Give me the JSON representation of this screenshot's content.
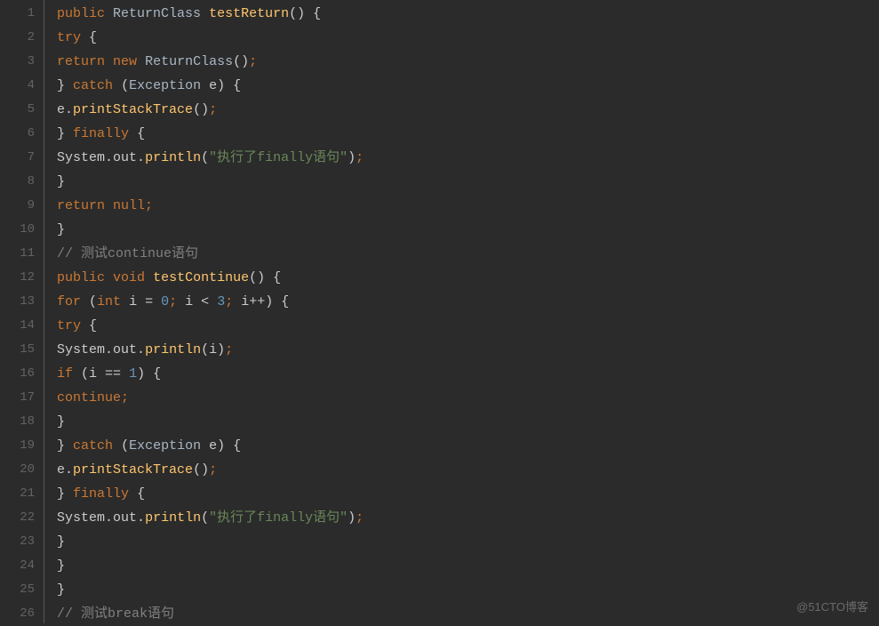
{
  "watermark": "@51CTO博客",
  "lines": [
    {
      "num": "1",
      "tokens": [
        {
          "t": "public",
          "c": "keyword"
        },
        {
          "t": " ",
          "c": "text"
        },
        {
          "t": "ReturnClass",
          "c": "type"
        },
        {
          "t": " ",
          "c": "text"
        },
        {
          "t": "testReturn",
          "c": "method"
        },
        {
          "t": "()",
          "c": "text"
        },
        {
          "t": " ",
          "c": "text"
        },
        {
          "t": "{",
          "c": "text"
        }
      ]
    },
    {
      "num": "2",
      "tokens": [
        {
          "t": "try",
          "c": "keyword"
        },
        {
          "t": " ",
          "c": "text"
        },
        {
          "t": "{",
          "c": "text"
        }
      ]
    },
    {
      "num": "3",
      "tokens": [
        {
          "t": "return",
          "c": "keyword"
        },
        {
          "t": " ",
          "c": "text"
        },
        {
          "t": "new",
          "c": "keyword"
        },
        {
          "t": " ",
          "c": "text"
        },
        {
          "t": "ReturnClass",
          "c": "type"
        },
        {
          "t": "()",
          "c": "text"
        },
        {
          "t": ";",
          "c": "punct"
        }
      ]
    },
    {
      "num": "4",
      "tokens": [
        {
          "t": "}",
          "c": "text"
        },
        {
          "t": " ",
          "c": "text"
        },
        {
          "t": "catch",
          "c": "keyword"
        },
        {
          "t": " ",
          "c": "text"
        },
        {
          "t": "(",
          "c": "text"
        },
        {
          "t": "Exception",
          "c": "type"
        },
        {
          "t": " e",
          "c": "text"
        },
        {
          "t": ")",
          "c": "text"
        },
        {
          "t": " ",
          "c": "text"
        },
        {
          "t": "{",
          "c": "text"
        }
      ]
    },
    {
      "num": "5",
      "tokens": [
        {
          "t": "e",
          "c": "text"
        },
        {
          "t": ".",
          "c": "text"
        },
        {
          "t": "printStackTrace",
          "c": "method"
        },
        {
          "t": "()",
          "c": "text"
        },
        {
          "t": ";",
          "c": "punct"
        }
      ]
    },
    {
      "num": "6",
      "tokens": [
        {
          "t": "}",
          "c": "text"
        },
        {
          "t": " ",
          "c": "text"
        },
        {
          "t": "finally",
          "c": "keyword"
        },
        {
          "t": " ",
          "c": "text"
        },
        {
          "t": "{",
          "c": "text"
        }
      ]
    },
    {
      "num": "7",
      "tokens": [
        {
          "t": "System",
          "c": "text"
        },
        {
          "t": ".",
          "c": "text"
        },
        {
          "t": "out",
          "c": "text"
        },
        {
          "t": ".",
          "c": "text"
        },
        {
          "t": "println",
          "c": "method"
        },
        {
          "t": "(",
          "c": "text"
        },
        {
          "t": "\"执行了finally语句\"",
          "c": "string"
        },
        {
          "t": ")",
          "c": "text"
        },
        {
          "t": ";",
          "c": "punct"
        }
      ]
    },
    {
      "num": "8",
      "tokens": [
        {
          "t": "}",
          "c": "text"
        }
      ]
    },
    {
      "num": "9",
      "tokens": [
        {
          "t": "return",
          "c": "keyword"
        },
        {
          "t": " ",
          "c": "text"
        },
        {
          "t": "null",
          "c": "keyword"
        },
        {
          "t": ";",
          "c": "punct"
        }
      ]
    },
    {
      "num": "10",
      "tokens": [
        {
          "t": "}",
          "c": "text"
        }
      ]
    },
    {
      "num": "11",
      "tokens": [
        {
          "t": "// 测试continue语句",
          "c": "comment"
        }
      ]
    },
    {
      "num": "12",
      "tokens": [
        {
          "t": "public",
          "c": "keyword"
        },
        {
          "t": " ",
          "c": "text"
        },
        {
          "t": "void",
          "c": "keyword"
        },
        {
          "t": " ",
          "c": "text"
        },
        {
          "t": "testContinue",
          "c": "method"
        },
        {
          "t": "()",
          "c": "text"
        },
        {
          "t": " ",
          "c": "text"
        },
        {
          "t": "{",
          "c": "text"
        }
      ]
    },
    {
      "num": "13",
      "tokens": [
        {
          "t": "for",
          "c": "keyword"
        },
        {
          "t": " ",
          "c": "text"
        },
        {
          "t": "(",
          "c": "text"
        },
        {
          "t": "int",
          "c": "keyword"
        },
        {
          "t": " i ",
          "c": "text"
        },
        {
          "t": "=",
          "c": "op"
        },
        {
          "t": " ",
          "c": "text"
        },
        {
          "t": "0",
          "c": "number"
        },
        {
          "t": ";",
          "c": "punct"
        },
        {
          "t": " i ",
          "c": "text"
        },
        {
          "t": "<",
          "c": "op"
        },
        {
          "t": " ",
          "c": "text"
        },
        {
          "t": "3",
          "c": "number"
        },
        {
          "t": ";",
          "c": "punct"
        },
        {
          "t": " i",
          "c": "text"
        },
        {
          "t": "++",
          "c": "op"
        },
        {
          "t": ")",
          "c": "text"
        },
        {
          "t": " ",
          "c": "text"
        },
        {
          "t": "{",
          "c": "text"
        }
      ]
    },
    {
      "num": "14",
      "tokens": [
        {
          "t": "try",
          "c": "keyword"
        },
        {
          "t": " ",
          "c": "text"
        },
        {
          "t": "{",
          "c": "text"
        }
      ]
    },
    {
      "num": "15",
      "tokens": [
        {
          "t": "System",
          "c": "text"
        },
        {
          "t": ".",
          "c": "text"
        },
        {
          "t": "out",
          "c": "text"
        },
        {
          "t": ".",
          "c": "text"
        },
        {
          "t": "println",
          "c": "method"
        },
        {
          "t": "(i)",
          "c": "text"
        },
        {
          "t": ";",
          "c": "punct"
        }
      ]
    },
    {
      "num": "16",
      "tokens": [
        {
          "t": "if",
          "c": "keyword"
        },
        {
          "t": " ",
          "c": "text"
        },
        {
          "t": "(i ",
          "c": "text"
        },
        {
          "t": "==",
          "c": "op"
        },
        {
          "t": " ",
          "c": "text"
        },
        {
          "t": "1",
          "c": "number"
        },
        {
          "t": ")",
          "c": "text"
        },
        {
          "t": " ",
          "c": "text"
        },
        {
          "t": "{",
          "c": "text"
        }
      ]
    },
    {
      "num": "17",
      "tokens": [
        {
          "t": "continue",
          "c": "keyword"
        },
        {
          "t": ";",
          "c": "punct"
        }
      ]
    },
    {
      "num": "18",
      "tokens": [
        {
          "t": "}",
          "c": "text"
        }
      ]
    },
    {
      "num": "19",
      "tokens": [
        {
          "t": "}",
          "c": "text"
        },
        {
          "t": " ",
          "c": "text"
        },
        {
          "t": "catch",
          "c": "keyword"
        },
        {
          "t": " ",
          "c": "text"
        },
        {
          "t": "(",
          "c": "text"
        },
        {
          "t": "Exception",
          "c": "type"
        },
        {
          "t": " e",
          "c": "text"
        },
        {
          "t": ")",
          "c": "text"
        },
        {
          "t": " ",
          "c": "text"
        },
        {
          "t": "{",
          "c": "text"
        }
      ]
    },
    {
      "num": "20",
      "tokens": [
        {
          "t": "e",
          "c": "text"
        },
        {
          "t": ".",
          "c": "text"
        },
        {
          "t": "printStackTrace",
          "c": "method"
        },
        {
          "t": "()",
          "c": "text"
        },
        {
          "t": ";",
          "c": "punct"
        }
      ]
    },
    {
      "num": "21",
      "tokens": [
        {
          "t": "}",
          "c": "text"
        },
        {
          "t": " ",
          "c": "text"
        },
        {
          "t": "finally",
          "c": "keyword"
        },
        {
          "t": " ",
          "c": "text"
        },
        {
          "t": "{",
          "c": "text"
        }
      ]
    },
    {
      "num": "22",
      "tokens": [
        {
          "t": "System",
          "c": "text"
        },
        {
          "t": ".",
          "c": "text"
        },
        {
          "t": "out",
          "c": "text"
        },
        {
          "t": ".",
          "c": "text"
        },
        {
          "t": "println",
          "c": "method"
        },
        {
          "t": "(",
          "c": "text"
        },
        {
          "t": "\"执行了finally语句\"",
          "c": "string"
        },
        {
          "t": ")",
          "c": "text"
        },
        {
          "t": ";",
          "c": "punct"
        }
      ]
    },
    {
      "num": "23",
      "tokens": [
        {
          "t": "}",
          "c": "text"
        }
      ]
    },
    {
      "num": "24",
      "tokens": [
        {
          "t": "}",
          "c": "text"
        }
      ]
    },
    {
      "num": "25",
      "tokens": [
        {
          "t": "}",
          "c": "text"
        }
      ]
    },
    {
      "num": "26",
      "tokens": [
        {
          "t": "// 测试break语句",
          "c": "comment"
        }
      ]
    }
  ]
}
